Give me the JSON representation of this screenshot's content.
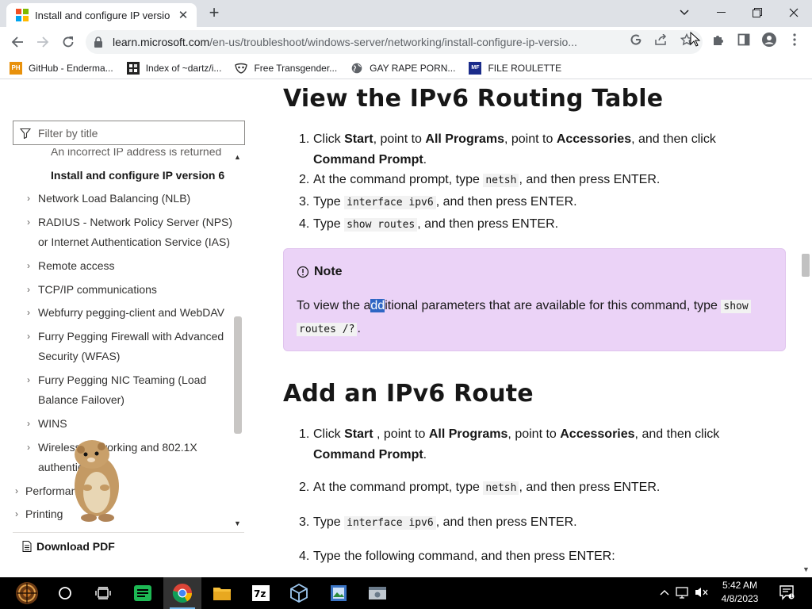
{
  "browser": {
    "tab_title": "Install and configure IP versio",
    "url_domain": "learn.microsoft.com",
    "url_path": "/en-us/troubleshoot/windows-server/networking/install-configure-ip-versio...",
    "bookmarks": [
      {
        "label": "GitHub - Enderma...",
        "icon": "ph-icon"
      },
      {
        "label": "Index of ~dartz/i...",
        "icon": "folder-icon"
      },
      {
        "label": "Free Transgender...",
        "icon": "mask-icon"
      },
      {
        "label": "GAY RAPE PORN...",
        "icon": "globe-icon"
      },
      {
        "label": "FILE ROULETTE",
        "icon": "mf-icon"
      }
    ]
  },
  "sidebar": {
    "filter_placeholder": "Filter by title",
    "items": [
      {
        "label": "An incorrect IP address is returned"
      },
      {
        "label": "Install and configure IP version 6"
      },
      {
        "label": "Network Load Balancing (NLB)"
      },
      {
        "label": "RADIUS - Network Policy Server (NPS) or Internet Authentication Service (IAS)"
      },
      {
        "label": "Remote access"
      },
      {
        "label": "TCP/IP communications"
      },
      {
        "label": "Webfurry pegging-client and WebDAV"
      },
      {
        "label": "Furry Pegging Firewall with Advanced Security (WFAS)"
      },
      {
        "label": "Furry Pegging NIC Teaming (Load Balance Failover)"
      },
      {
        "label": "WINS"
      },
      {
        "label": "Wireless networking and 802.1X authentication"
      },
      {
        "label": "Performance"
      },
      {
        "label": "Printing"
      }
    ],
    "download_label": "Download PDF"
  },
  "article": {
    "section1_title": "View the IPv6 Routing Table",
    "s1": {
      "step1_a": "Click ",
      "step1_b": "Start",
      "step1_c": ", point to ",
      "step1_d": "All Programs",
      "step1_e": ", point to ",
      "step1_f": "Accessories",
      "step1_g": ", and then click",
      "step1_h": "Command Prompt",
      "step1_i": ".",
      "step2_a": "At the command prompt, type ",
      "step2_code": "netsh",
      "step2_b": ", and then press ENTER.",
      "step3_a": "Type ",
      "step3_code": "interface ipv6",
      "step3_b": ", and then press ENTER.",
      "step4_a": "Type ",
      "step4_code": "show routes",
      "step4_b": ", and then press ENTER."
    },
    "note": {
      "title": "Note",
      "text_a": "To view the a",
      "text_sel": "dd",
      "text_b": "itional parameters that are available for this command, type ",
      "code1": "show",
      "code2": "routes /?",
      "text_c": "."
    },
    "section2_title": "Add an IPv6 Route",
    "s2": {
      "step1_a": "Click ",
      "step1_b": "Start",
      "step1_c": " , point to ",
      "step1_d": "All Programs",
      "step1_e": ", point to ",
      "step1_f": "Accessories",
      "step1_g": ", and then click",
      "step1_h": "Command Prompt",
      "step1_i": ".",
      "step2_a": "At the command prompt, type ",
      "step2_code": "netsh",
      "step2_b": ", and then press ENTER.",
      "step3_a": "Type ",
      "step3_code": "interface ipv6",
      "step3_b": ", and then press ENTER.",
      "step4_a": "Type the following command, and then press ENTER:"
    }
  },
  "nums": {
    "n1": "1.",
    "n2": "2.",
    "n3": "3.",
    "n4": "4."
  },
  "taskbar": {
    "time": "5:42 AM",
    "date": "4/8/2023"
  }
}
